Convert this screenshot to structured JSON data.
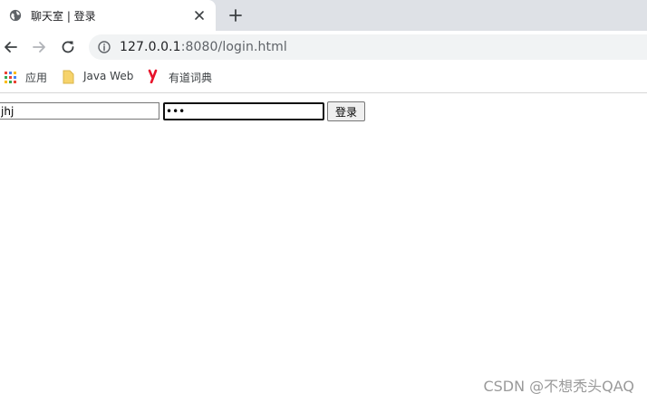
{
  "tab": {
    "title": "聊天室 | 登录",
    "favicon_icon": "globe-icon",
    "close_icon": "close-icon"
  },
  "new_tab_icon": "plus-icon",
  "toolbar": {
    "back_icon": "arrow-left-icon",
    "forward_icon": "arrow-right-icon",
    "reload_icon": "reload-icon",
    "info_icon": "info-icon",
    "url_host": "127.0.0.1",
    "url_path": ":8080/login.html"
  },
  "bookmarks": [
    {
      "label": "应用",
      "icon": "apps-grid-icon"
    },
    {
      "label": "Java Web",
      "icon": "folder-icon"
    },
    {
      "label": "有道词典",
      "icon": "youdao-icon"
    }
  ],
  "form": {
    "username_value": "jhj",
    "password_value": "•••",
    "login_button_label": "登录"
  },
  "watermark": "CSDN @不想秃头QAQ",
  "colors": {
    "tabstrip_bg": "#dee1e6",
    "omnibox_bg": "#f1f3f4",
    "youdao_red": "#e8132b",
    "folder_yellow": "#f6d36b"
  }
}
